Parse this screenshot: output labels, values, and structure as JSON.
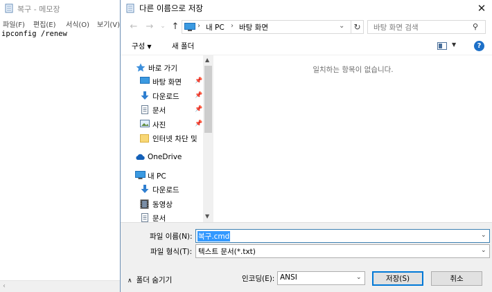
{
  "notepad": {
    "title": "복구 - 메모장",
    "menu": [
      "파일(F)",
      "편집(E)",
      "서식(O)",
      "보기(V)"
    ],
    "content": "ipconfig /renew",
    "scroll_left_icon": "chevron-left-icon"
  },
  "dialog": {
    "title": "다른 이름으로 저장",
    "close_label": "✕",
    "address": {
      "crumbs": [
        "내 PC",
        "바탕 화면"
      ],
      "separator": "›"
    },
    "search": {
      "placeholder": "바탕 화면 검색"
    },
    "toolbar": {
      "organize_label": "구성",
      "new_folder_label": "새 폴더"
    },
    "nav": {
      "quick_access": "바로 가기",
      "items": [
        {
          "label": "바탕 화면",
          "icon": "desktop-icon",
          "pinned": true
        },
        {
          "label": "다운로드",
          "icon": "download-icon",
          "pinned": true
        },
        {
          "label": "문서",
          "icon": "document-icon",
          "pinned": true
        },
        {
          "label": "사진",
          "icon": "pictures-icon",
          "pinned": true
        },
        {
          "label": "인터넷 차단 및 ",
          "icon": "folder-icon",
          "pinned": false
        }
      ],
      "onedrive": "OneDrive",
      "this_pc": "내 PC",
      "pc_items": [
        {
          "label": "다운로드",
          "icon": "download-icon"
        },
        {
          "label": "동영상",
          "icon": "videos-icon"
        },
        {
          "label": "문서",
          "icon": "document-icon"
        }
      ]
    },
    "empty_message": "일치하는 항목이 없습니다.",
    "file_name_label": "파일 이름(N):",
    "file_name_value": "복구.cmd",
    "file_type_label": "파일 형식(T):",
    "file_type_value": "텍스트 문서(*.txt)",
    "hide_folders_label": "폴더 숨기기",
    "encoding_label": "인코딩(E):",
    "encoding_value": "ANSI",
    "save_label": "저장(S)",
    "cancel_label": "취소",
    "colors": {
      "accent": "#0078d7",
      "selection": "#3399ff",
      "help": "#1d70c8"
    }
  }
}
